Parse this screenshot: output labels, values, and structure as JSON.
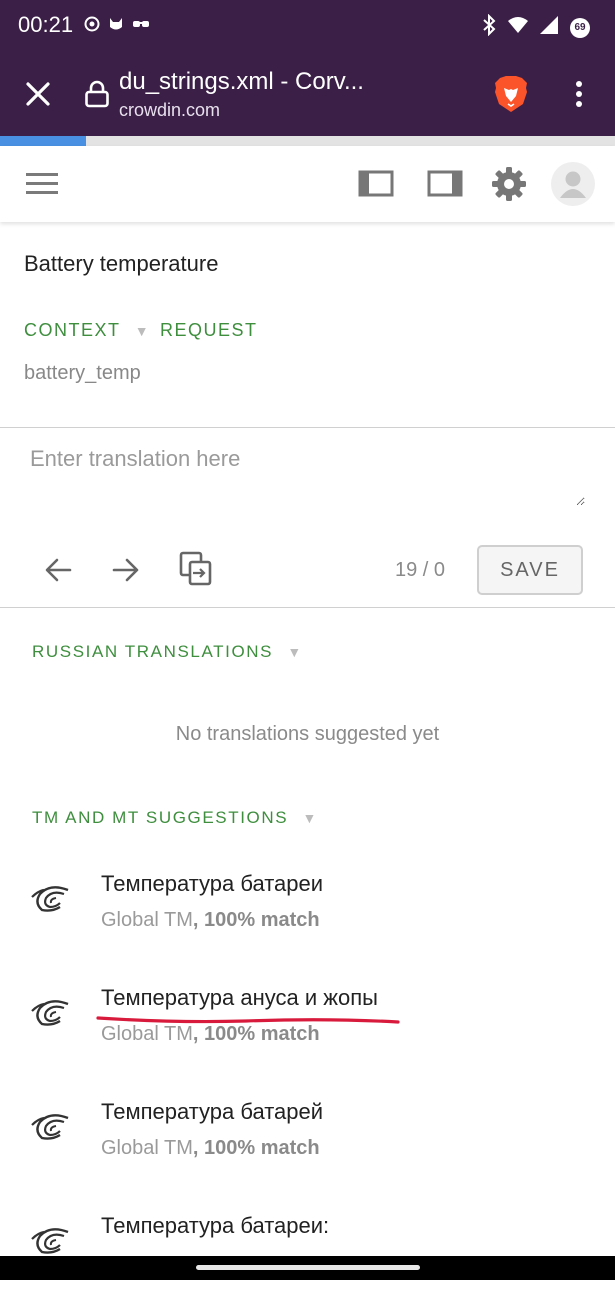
{
  "status_bar": {
    "time": "00:21",
    "battery_level": "69"
  },
  "browser": {
    "page_title": "du_strings.xml - Corv...",
    "domain": "crowdin.com",
    "load_progress_fraction": 0.14
  },
  "editor": {
    "source_string": "Battery temperature",
    "context_label": "CONTEXT",
    "request_label": "REQUEST",
    "string_key": "battery_temp",
    "translation_placeholder": "Enter translation here",
    "translation_value": "",
    "counter": "19 / 0",
    "save_label": "SAVE"
  },
  "russian_translations": {
    "title": "RUSSIAN TRANSLATIONS",
    "empty_message": "No translations suggested yet"
  },
  "tm_mt": {
    "title": "TM AND MT SUGGESTIONS",
    "items": [
      {
        "text": "Температура батареи",
        "source": "Global TM",
        "match": ", 100% match"
      },
      {
        "text": "Температура ануса и жопы",
        "source": "Global TM",
        "match": ", 100% match"
      },
      {
        "text": "Температура батарей",
        "source": "Global TM",
        "match": ", 100% match"
      },
      {
        "text": "Температура батареи:",
        "source": "",
        "match": ""
      }
    ]
  },
  "colors": {
    "browser_bar": "#3b1f47",
    "accent_green": "#3e8e3e",
    "annotation_red": "#d81b3c"
  }
}
